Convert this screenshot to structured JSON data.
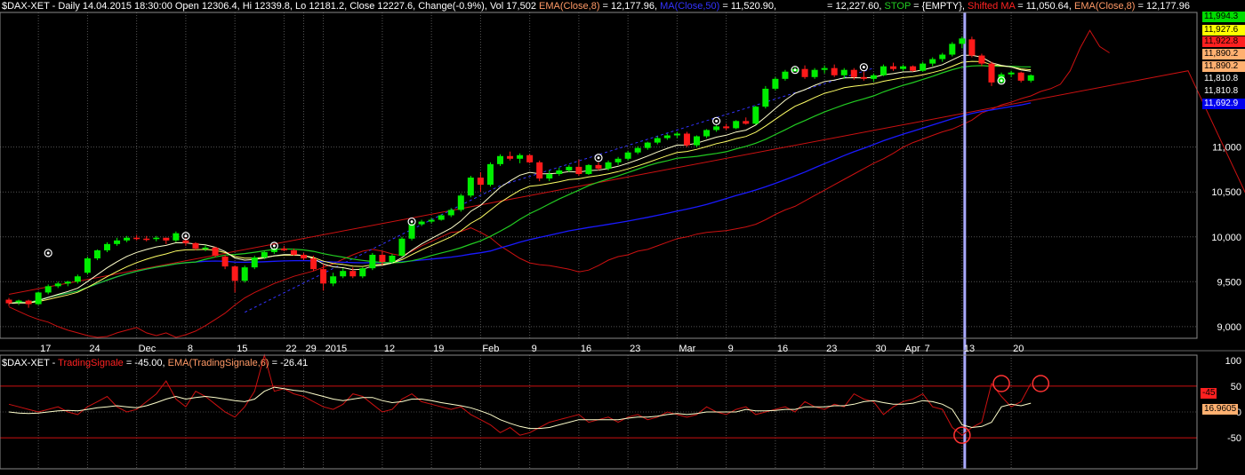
{
  "header": {
    "symbol": "$DAX-XET",
    "info": "- Daily 14.04.2015 18:30:00 Open 12306.4, Hi 12339.8, Lo 12181.2, Close 12227.6, Change(-0.9%), Vol 17,502",
    "ema_label": "EMA(Close,8)",
    "ema_value": " = 12,177.96,",
    "ma_label": "MA(Close,50)",
    "ma_value": " = 11,520.90,",
    "close_value": "= 12,227.60,",
    "stop_label": "STOP",
    "stop_value": " = {EMPTY},",
    "shifted_label": "Shifted MA",
    "shifted_value": " = 11,050.64,",
    "ema2_label": "EMA(Close,8)",
    "ema2_value": " = 12,177.96"
  },
  "lower_header": {
    "symbol": "$DAX-XET",
    "sep": " - ",
    "ts_label": "TradingSignale",
    "ts_value": " = -45.00, ",
    "ema_label": "EMA(TradingSignale,6)",
    "ema_value": " = -26.41"
  },
  "price_boxes": [
    {
      "label": "11,994.3",
      "color": "#00dd00"
    },
    {
      "label": "11,927.6",
      "color": "#ffff00"
    },
    {
      "label": "11,922.8",
      "color": "#ff2020"
    },
    {
      "label": "11,890.2",
      "color": "#ffb070"
    },
    {
      "label": "11,890.2",
      "color": "#ffb070"
    },
    {
      "label": "11,810.8",
      "color": ""
    },
    {
      "label": "11,810.8",
      "color": ""
    },
    {
      "label": "11,692.9",
      "color": "#0000ee"
    }
  ],
  "lower_boxes": [
    {
      "label": "-45",
      "color": "#ff2020"
    },
    {
      "label": "16.9605",
      "color": "#ffb070"
    }
  ],
  "colors": {
    "up": "#00ee00",
    "down": "#ff1a1a",
    "ema": "#ffffcc",
    "ema50": "#ffff66",
    "ma_green": "#22cc22",
    "ma_blue": "#1a1aff",
    "shifted": "#cc1111",
    "vline": "#aaaaff"
  },
  "chart_data": [
    {
      "type": "line",
      "title": "",
      "ylim": [
        8870,
        12500
      ],
      "y_ticks": [
        9000,
        9500,
        10000,
        10500,
        11000
      ],
      "y_tick_labels": [
        "9,000",
        "9,500",
        "10,000",
        "10,500",
        "11,000"
      ],
      "x_ticks": [
        {
          "i": 3,
          "label": "17"
        },
        {
          "i": 8,
          "label": "24"
        },
        {
          "i": 13,
          "label": "Dec"
        },
        {
          "i": 18,
          "label": "8"
        },
        {
          "i": 23,
          "label": "15"
        },
        {
          "i": 28,
          "label": "22"
        },
        {
          "i": 30,
          "label": "29"
        },
        {
          "i": 32,
          "label": "2015"
        },
        {
          "i": 38,
          "label": "12"
        },
        {
          "i": 43,
          "label": "19"
        },
        {
          "i": 48,
          "label": "Feb"
        },
        {
          "i": 53,
          "label": "9"
        },
        {
          "i": 58,
          "label": "16"
        },
        {
          "i": 63,
          "label": "23"
        },
        {
          "i": 68,
          "label": "Mar"
        },
        {
          "i": 73,
          "label": "9"
        },
        {
          "i": 78,
          "label": "16"
        },
        {
          "i": 83,
          "label": "23"
        },
        {
          "i": 88,
          "label": "30"
        },
        {
          "i": 91,
          "label": "Apr"
        },
        {
          "i": 93,
          "label": "7"
        },
        {
          "i": 97,
          "label": "13"
        },
        {
          "i": 102,
          "label": "20"
        }
      ],
      "candles": [
        [
          9300,
          9320,
          9230,
          9260
        ],
        [
          9270,
          9300,
          9240,
          9290
        ],
        [
          9290,
          9300,
          9210,
          9250
        ],
        [
          9250,
          9390,
          9240,
          9380
        ],
        [
          9380,
          9470,
          9360,
          9450
        ],
        [
          9450,
          9500,
          9430,
          9480
        ],
        [
          9480,
          9510,
          9450,
          9500
        ],
        [
          9500,
          9580,
          9480,
          9560
        ],
        [
          9600,
          9780,
          9580,
          9760
        ],
        [
          9760,
          9860,
          9740,
          9850
        ],
        [
          9850,
          9940,
          9830,
          9920
        ],
        [
          9920,
          9990,
          9900,
          9960
        ],
        [
          9960,
          10010,
          9940,
          9990
        ],
        [
          9990,
          10020,
          9960,
          9980
        ],
        [
          9980,
          10010,
          9950,
          9975
        ],
        [
          9975,
          10010,
          9950,
          9990
        ],
        [
          9990,
          9990,
          9920,
          9960
        ],
        [
          9960,
          10060,
          9940,
          10040
        ],
        [
          9960,
          9990,
          9900,
          9930
        ],
        [
          9930,
          9940,
          9850,
          9870
        ],
        [
          9870,
          9910,
          9840,
          9880
        ],
        [
          9880,
          9890,
          9770,
          9790
        ],
        [
          9780,
          9800,
          9640,
          9670
        ],
        [
          9670,
          9680,
          9380,
          9510
        ],
        [
          9510,
          9680,
          9490,
          9660
        ],
        [
          9660,
          9790,
          9640,
          9770
        ],
        [
          9770,
          9840,
          9750,
          9830
        ],
        [
          9830,
          9880,
          9810,
          9870
        ],
        [
          9870,
          9900,
          9840,
          9850
        ],
        [
          9850,
          9870,
          9790,
          9800
        ],
        [
          9800,
          9820,
          9740,
          9760
        ],
        [
          9760,
          9790,
          9620,
          9640
        ],
        [
          9640,
          9700,
          9400,
          9480
        ],
        [
          9480,
          9600,
          9450,
          9560
        ],
        [
          9560,
          9650,
          9540,
          9620
        ],
        [
          9620,
          9660,
          9540,
          9560
        ],
        [
          9560,
          9660,
          9540,
          9650
        ],
        [
          9650,
          9820,
          9630,
          9800
        ],
        [
          9800,
          9840,
          9680,
          9720
        ],
        [
          9720,
          9810,
          9700,
          9790
        ],
        [
          9790,
          10000,
          9780,
          9980
        ],
        [
          9980,
          10160,
          9960,
          10140
        ],
        [
          10140,
          10190,
          10120,
          10170
        ],
        [
          10170,
          10210,
          10150,
          10190
        ],
        [
          10190,
          10250,
          10180,
          10240
        ],
        [
          10240,
          10320,
          10220,
          10300
        ],
        [
          10300,
          10480,
          10280,
          10460
        ],
        [
          10460,
          10680,
          10440,
          10660
        ],
        [
          10660,
          10720,
          10500,
          10580
        ],
        [
          10580,
          10830,
          10560,
          10810
        ],
        [
          10810,
          10920,
          10790,
          10900
        ],
        [
          10900,
          10950,
          10850,
          10870
        ],
        [
          10870,
          10930,
          10820,
          10910
        ],
        [
          10910,
          10920,
          10820,
          10830
        ],
        [
          10830,
          10850,
          10620,
          10650
        ],
        [
          10650,
          10740,
          10620,
          10700
        ],
        [
          10700,
          10770,
          10680,
          10740
        ],
        [
          10740,
          10800,
          10720,
          10780
        ],
        [
          10780,
          10860,
          10680,
          10700
        ],
        [
          10700,
          10810,
          10690,
          10800
        ],
        [
          10800,
          10830,
          10740,
          10760
        ],
        [
          10760,
          10850,
          10740,
          10830
        ],
        [
          10830,
          10890,
          10800,
          10870
        ],
        [
          10870,
          10960,
          10850,
          10940
        ],
        [
          10940,
          11010,
          10920,
          10990
        ],
        [
          10990,
          11060,
          10970,
          11050
        ],
        [
          11050,
          11120,
          11030,
          11100
        ],
        [
          11100,
          11150,
          11080,
          11130
        ],
        [
          11130,
          11170,
          11100,
          11150
        ],
        [
          11150,
          11170,
          11000,
          11020
        ],
        [
          11020,
          11130,
          11000,
          11120
        ],
        [
          11120,
          11200,
          11100,
          11190
        ],
        [
          11190,
          11250,
          11170,
          11230
        ],
        [
          11230,
          11260,
          11190,
          11210
        ],
        [
          11210,
          11300,
          11200,
          11290
        ],
        [
          11290,
          11330,
          11250,
          11260
        ],
        [
          11260,
          11460,
          11250,
          11450
        ],
        [
          11450,
          11680,
          11430,
          11650
        ],
        [
          11650,
          11780,
          11630,
          11760
        ],
        [
          11760,
          11860,
          11740,
          11840
        ],
        [
          11840,
          11900,
          11860,
          11870
        ],
        [
          11870,
          11910,
          11760,
          11780
        ],
        [
          11780,
          11880,
          11760,
          11860
        ],
        [
          11860,
          11910,
          11820,
          11880
        ],
        [
          11880,
          11920,
          11780,
          11800
        ],
        [
          11800,
          11880,
          11760,
          11860
        ],
        [
          11860,
          11880,
          11750,
          11780
        ],
        [
          11780,
          11840,
          11740,
          11760
        ],
        [
          11760,
          11820,
          11730,
          11800
        ],
        [
          11800,
          11920,
          11790,
          11900
        ],
        [
          11900,
          11940,
          11850,
          11870
        ],
        [
          11870,
          11920,
          11850,
          11900
        ],
        [
          11900,
          11910,
          11840,
          11850
        ],
        [
          11850,
          11950,
          11840,
          11930
        ],
        [
          11930,
          12000,
          11900,
          11980
        ],
        [
          11980,
          12050,
          11950,
          12030
        ],
        [
          12030,
          12170,
          12010,
          12150
        ],
        [
          12150,
          12230,
          12100,
          12210
        ],
        [
          12200,
          12230,
          12000,
          12020
        ],
        [
          12020,
          12040,
          11900,
          11930
        ],
        [
          11930,
          11950,
          11680,
          11720
        ],
        [
          11720,
          11830,
          11700,
          11810
        ],
        [
          11810,
          11850,
          11780,
          11830
        ],
        [
          11830,
          11840,
          11720,
          11740
        ],
        [
          11740,
          11810,
          11720,
          11800
        ]
      ],
      "shifted_ma": [
        9220,
        9170,
        9120,
        9080,
        9050,
        9000,
        8960,
        8930,
        8900,
        8880,
        8890,
        8930,
        8960,
        8990,
        8930,
        8900,
        8930,
        8880,
        8910,
        8950,
        9010,
        9080,
        9150,
        9240,
        9320,
        9380,
        9430,
        9480,
        9520,
        9560,
        9590,
        9620,
        9660,
        9700,
        9750,
        9800,
        9840,
        9860,
        9840,
        9810,
        9790,
        9840,
        9900,
        9950,
        10000,
        10050,
        10060,
        10100,
        10050,
        9990,
        9900,
        9830,
        9760,
        9710,
        9690,
        9680,
        9660,
        9640,
        9610,
        9630,
        9680,
        9740,
        9780,
        9800,
        9840,
        9860,
        9900,
        9940,
        9980,
        10000,
        10030,
        10050,
        10060,
        10070,
        10090,
        10110,
        10140,
        10190,
        10250,
        10300,
        10340,
        10400,
        10460,
        10520,
        10580,
        10640,
        10700,
        10760,
        10820,
        10870,
        10930,
        11000,
        11050,
        11090,
        11130,
        11170,
        11200,
        11250,
        11300,
        11380,
        11420,
        11470,
        11500,
        11540,
        11570,
        11620,
        11650,
        11700,
        11850,
        12100,
        12300,
        12120,
        12050
      ],
      "stop_markers": [
        [
          4,
          9820
        ],
        [
          18,
          10010
        ],
        [
          27,
          9900
        ],
        [
          41,
          10170
        ],
        [
          60,
          10880
        ],
        [
          72,
          11290
        ],
        [
          80,
          11860
        ],
        [
          87,
          11890
        ],
        [
          101,
          11740
        ]
      ],
      "trend_upper": [
        [
          0,
          9360
        ],
        [
          120,
          11850
        ],
        [
          126,
          10450
        ]
      ],
      "trend_lower": [
        [
          24,
          9160
        ],
        [
          50,
          10570
        ],
        [
          88,
          11880
        ]
      ]
    },
    {
      "type": "line",
      "title": "",
      "ylim": [
        -110,
        110
      ],
      "y_ticks": [
        100,
        50,
        0,
        -50
      ],
      "y_tick_labels": [
        "100",
        "50",
        "0",
        "-50"
      ],
      "levels": [
        50,
        -50
      ],
      "trading_signal": [
        15,
        10,
        5,
        0,
        5,
        10,
        0,
        -5,
        10,
        20,
        30,
        10,
        0,
        5,
        20,
        35,
        60,
        25,
        10,
        40,
        30,
        15,
        0,
        -10,
        10,
        40,
        110,
        40,
        45,
        35,
        30,
        20,
        10,
        5,
        15,
        35,
        30,
        15,
        0,
        5,
        25,
        35,
        20,
        15,
        10,
        5,
        10,
        -5,
        -15,
        -25,
        -40,
        -30,
        -45,
        -40,
        -30,
        -20,
        -15,
        -10,
        -5,
        -20,
        -15,
        -10,
        -20,
        -10,
        -5,
        -15,
        -10,
        0,
        -5,
        -10,
        -5,
        10,
        0,
        -5,
        5,
        10,
        -5,
        0,
        5,
        10,
        0,
        20,
        10,
        5,
        15,
        10,
        35,
        25,
        20,
        -5,
        10,
        20,
        25,
        35,
        10,
        5,
        -30,
        -45,
        -30,
        -20,
        55,
        30,
        10,
        20,
        55
      ],
      "signal_ema": [
        0,
        -2,
        -3,
        -2,
        0,
        2,
        3,
        2,
        5,
        8,
        10,
        12,
        10,
        8,
        12,
        18,
        25,
        30,
        25,
        28,
        30,
        28,
        25,
        22,
        20,
        25,
        40,
        48,
        45,
        42,
        40,
        35,
        30,
        25,
        22,
        25,
        28,
        28,
        22,
        18,
        20,
        25,
        25,
        22,
        18,
        15,
        12,
        8,
        2,
        -5,
        -15,
        -22,
        -28,
        -32,
        -32,
        -30,
        -25,
        -20,
        -15,
        -15,
        -15,
        -15,
        -15,
        -12,
        -10,
        -10,
        -8,
        -5,
        -3,
        -5,
        -3,
        0,
        0,
        0,
        0,
        5,
        2,
        2,
        3,
        5,
        5,
        10,
        10,
        10,
        12,
        12,
        15,
        20,
        22,
        18,
        15,
        15,
        17,
        22,
        20,
        15,
        5,
        -25,
        -30,
        -28,
        -20,
        10,
        15,
        12,
        17
      ],
      "circles": [
        [
          97,
          -45
        ],
        [
          101,
          55
        ],
        [
          105,
          55
        ]
      ]
    }
  ]
}
